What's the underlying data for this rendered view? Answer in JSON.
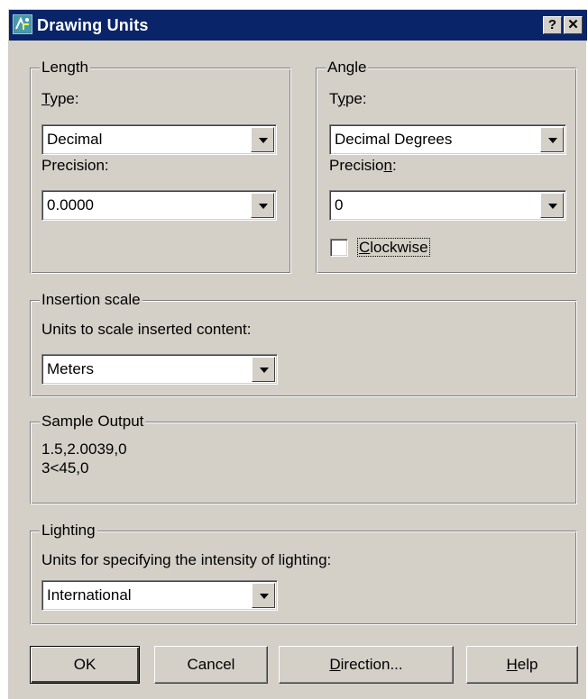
{
  "window": {
    "title": "Drawing Units",
    "help_glyph": "?",
    "close_glyph": "✕",
    "app_icon": "drawing-units-app-icon"
  },
  "length": {
    "group_label": "Length",
    "type_label_underlined": "T",
    "type_label_rest": "ype:",
    "type_value": "Decimal",
    "precision_label": "Precision:",
    "precision_value": "0.0000"
  },
  "angle": {
    "group_label": "Angle",
    "type_label_first": "T",
    "type_label_underlined": "y",
    "type_label_rest": "pe:",
    "type_value": "Decimal Degrees",
    "precision_label_start": "Precisio",
    "precision_label_underlined": "n",
    "precision_label_end": ":",
    "precision_value": "0",
    "clockwise_underlined": "C",
    "clockwise_rest": "lockwise",
    "clockwise_checked": false
  },
  "insertion_scale": {
    "group_label": "Insertion scale",
    "description": "Units to scale inserted content:",
    "value": "Meters"
  },
  "sample_output": {
    "group_label": "Sample Output",
    "line1": "1.5,2.0039,0",
    "line2": "3<45,0"
  },
  "lighting": {
    "group_label": "Lighting",
    "description": "Units for specifying the intensity of lighting:",
    "value": "International"
  },
  "buttons": {
    "ok": "OK",
    "cancel": "Cancel",
    "direction_underlined": "D",
    "direction_rest": "irection...",
    "help_underlined": "H",
    "help_rest": "elp"
  },
  "colors": {
    "dialog_face": "#d4d0c8",
    "titlebar": "#0a246a",
    "field": "#ffffff"
  }
}
